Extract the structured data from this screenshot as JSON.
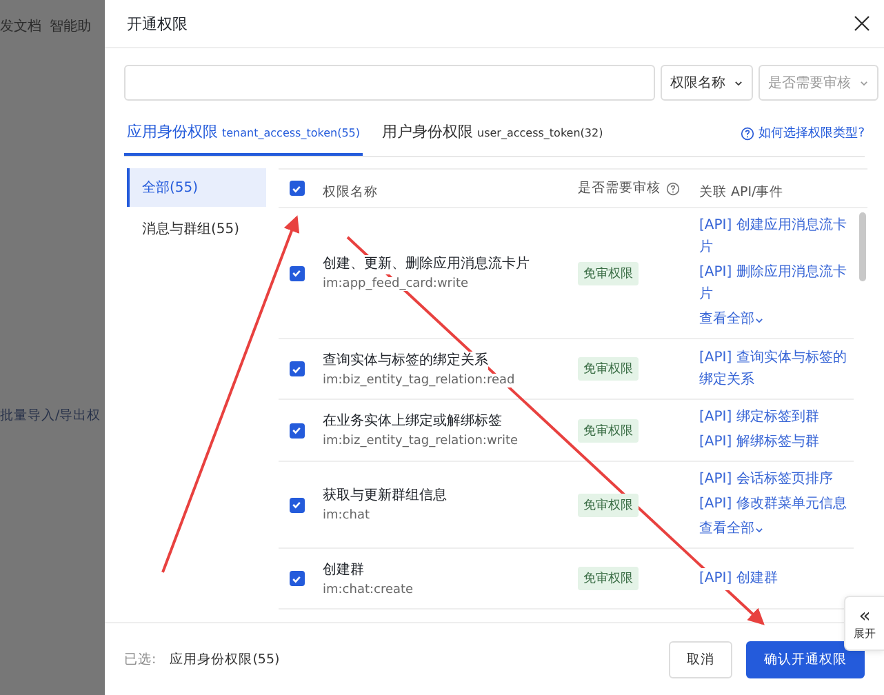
{
  "background_page": {
    "nav": [
      "发文档",
      "智能助"
    ],
    "link": "批量导入/导出权"
  },
  "dialog": {
    "title": "开通权限",
    "filters": [
      {
        "label": "权限名称",
        "muted": false
      },
      {
        "label": "是否需要审核",
        "muted": true
      }
    ],
    "tabs": [
      {
        "label": "应用身份权限",
        "token": "tenant_access_token(55)",
        "selected": true
      },
      {
        "label": "用户身份权限",
        "token": "user_access_token(32)",
        "selected": false
      }
    ],
    "help_link": "如何选择权限类型?",
    "categories": [
      {
        "label": "全部(55)",
        "selected": true
      },
      {
        "label": "消息与群组(55)",
        "selected": false
      }
    ],
    "table": {
      "columns": [
        "权限名称",
        "是否需要审核",
        "关联 API/事件"
      ],
      "all_checked": true,
      "rows": [
        {
          "checked": true,
          "name": "创建、更新、删除应用消息流卡片",
          "scope": "im:app_feed_card:write",
          "review": "免审权限",
          "apis": [
            "[API] 创建应用消息流卡片",
            "[API] 删除应用消息流卡片"
          ],
          "more": "查看全部"
        },
        {
          "checked": true,
          "name": "查询实体与标签的绑定关系",
          "scope": "im:biz_entity_tag_relation:read",
          "review": "免审权限",
          "apis": [
            "[API] 查询实体与标签的绑定关系"
          ]
        },
        {
          "checked": true,
          "name": "在业务实体上绑定或解绑标签",
          "scope": "im:biz_entity_tag_relation:write",
          "review": "免审权限",
          "apis": [
            "[API] 绑定标签到群",
            "[API] 解绑标签与群"
          ]
        },
        {
          "checked": true,
          "name": "获取与更新群组信息",
          "scope": "im:chat",
          "review": "免审权限",
          "apis": [
            "[API] 会话标签页排序",
            "[API] 修改群菜单元信息"
          ],
          "more": "查看全部"
        },
        {
          "checked": true,
          "name": "创建群",
          "scope": "im:chat:create",
          "review": "免审权限",
          "apis": [
            "[API] 创建群"
          ]
        }
      ]
    },
    "footer": {
      "selected_label": "已选:",
      "selected_value": "应用身份权限(55)",
      "buttons": [
        {
          "label": "取消",
          "kind": "secondary"
        },
        {
          "label": "确认开通权限",
          "kind": "primary"
        }
      ]
    },
    "expand": {
      "icon": "«",
      "label": "展开"
    }
  }
}
